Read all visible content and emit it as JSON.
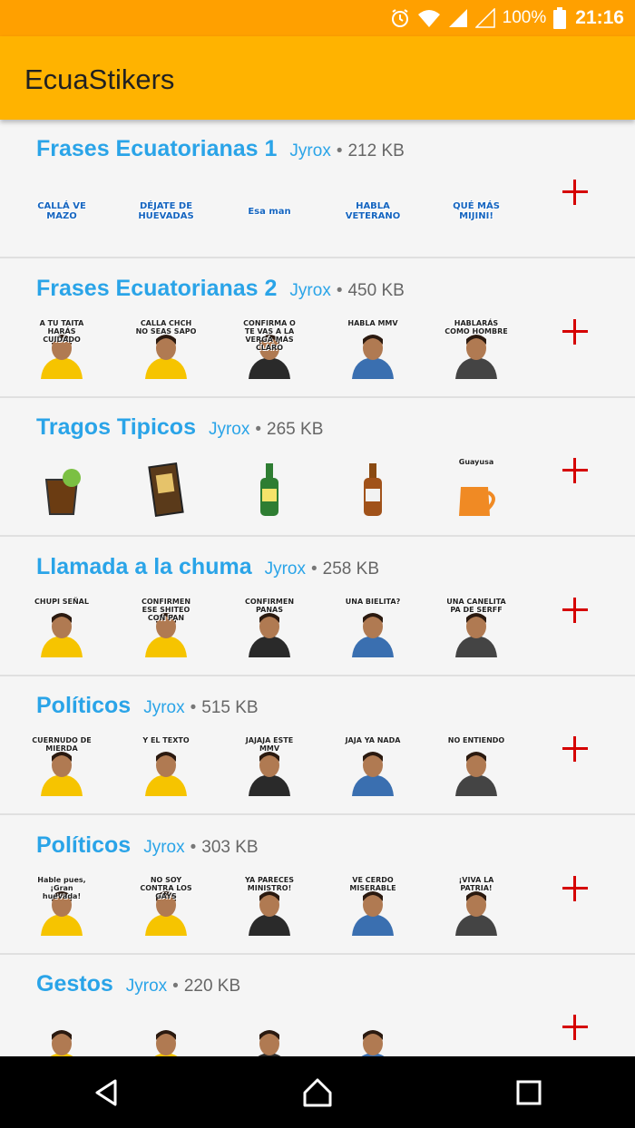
{
  "status": {
    "battery": "100%",
    "time": "21:16"
  },
  "app": {
    "title": "EcuaStikers"
  },
  "packs": [
    {
      "name": "Frases Ecuatorianas 1",
      "author": "Jyrox",
      "sep": "•",
      "size": "212 KB",
      "kind": "words",
      "stickers": [
        "CALLÁ VE MAZO",
        "DÉJATE DE HUEVADAS",
        "Esa man",
        "HABLA VETERANO",
        "QUÉ MÁS MIJINI!"
      ]
    },
    {
      "name": "Frases Ecuatorianas 2",
      "author": "Jyrox",
      "sep": "•",
      "size": "450 KB",
      "kind": "people",
      "stickers": [
        "A TU TAITA HARÁS CUIDADO",
        "CALLA CHCH NO SEAS SAPO",
        "CONFIRMA O TE VAS A LA VERGA MÁS CLARO",
        "HABLA MMV",
        "HABLARÁS COMO HOMBRE"
      ]
    },
    {
      "name": "Tragos Tipicos",
      "author": "Jyrox",
      "sep": "•",
      "size": "265 KB",
      "kind": "drinks",
      "stickers": [
        "",
        "",
        "",
        "",
        "Guayusa"
      ]
    },
    {
      "name": "Llamada a la chuma",
      "author": "Jyrox",
      "sep": "•",
      "size": "258 KB",
      "kind": "mixed",
      "stickers": [
        "CHUPI SEÑAL",
        "CONFIRMEN ESE SHITEO CON PAN",
        "CONFIRMEN PANAS",
        "UNA BIELITA?",
        "UNA CANELITA PA DE SERFF"
      ]
    },
    {
      "name": "Políticos",
      "author": "Jyrox",
      "sep": "•",
      "size": "515 KB",
      "kind": "people",
      "stickers": [
        "CUERNUDO DE MIERDA",
        "Y EL TEXTO",
        "JAJAJA ESTE MMV",
        "JAJA YA NADA",
        "NO ENTIENDO"
      ]
    },
    {
      "name": "Políticos",
      "author": "Jyrox",
      "sep": "•",
      "size": "303 KB",
      "kind": "people",
      "stickers": [
        "Hable pues, ¡Gran huevada!",
        "NO SOY CONTRA LOS GAYS",
        "YA PARECES MINISTRO!",
        "VE CERDO MISERABLE",
        "¡VIVA LA PATRIA!"
      ]
    },
    {
      "name": "Gestos",
      "author": "Jyrox",
      "sep": "•",
      "size": "220 KB",
      "kind": "people",
      "stickers": [
        "",
        "",
        "",
        ""
      ]
    }
  ],
  "colors": {
    "statusbar": "#ffa000",
    "appbar": "#ffb300",
    "accent_text": "#2aa4e8",
    "add": "#d50000"
  },
  "icons": [
    "alarm-icon",
    "wifi-icon",
    "signal-icon",
    "battery-icon",
    "add-icon",
    "back-icon",
    "home-icon",
    "recents-icon"
  ]
}
